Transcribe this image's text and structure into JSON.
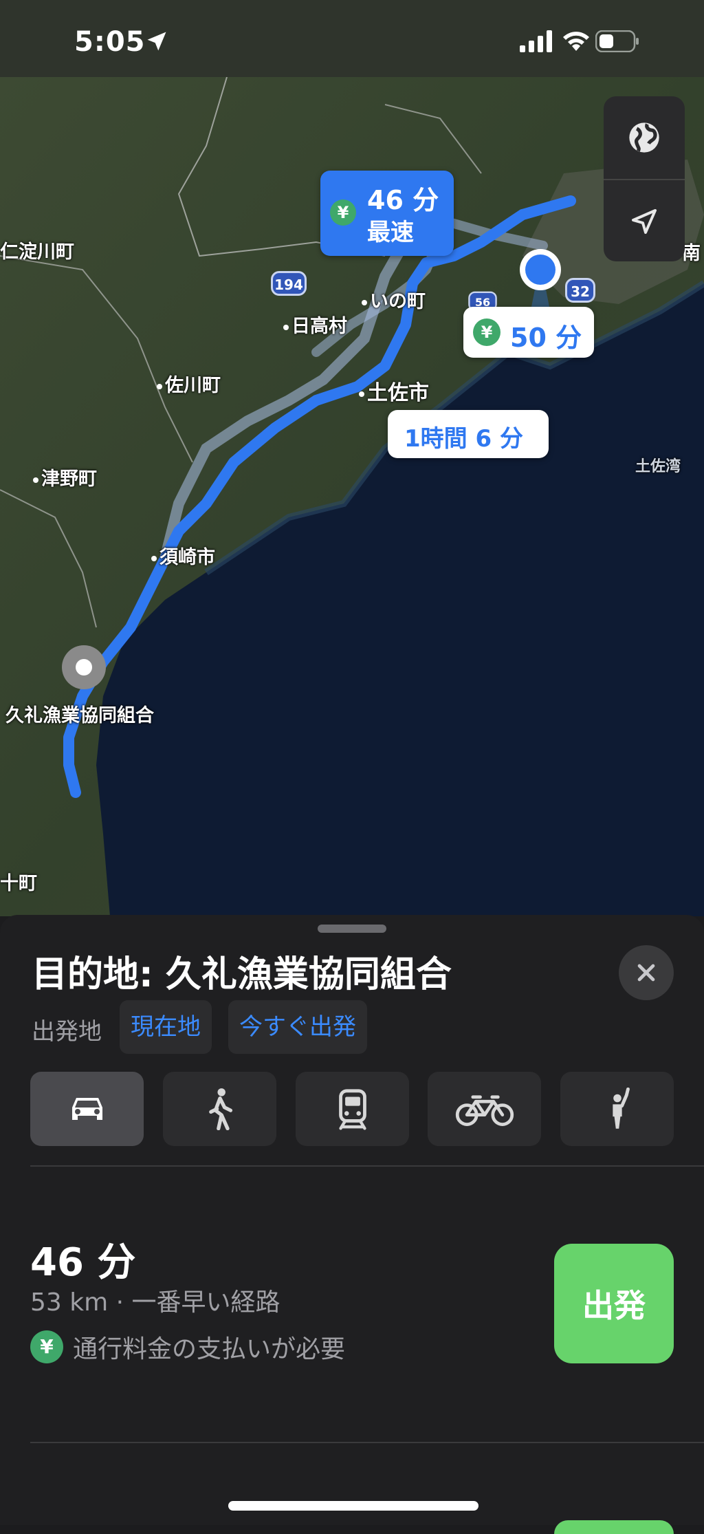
{
  "status": {
    "time": "5:05"
  },
  "map": {
    "places": {
      "niyodogawa": "仁淀川町",
      "ino": "いの町",
      "hidaka": "日高村",
      "sakawa": "佐川町",
      "tosa": "土佐市",
      "tsuno": "津野町",
      "susaki": "須崎市",
      "destination": "久礼漁業協同組合",
      "tosawan": "土佐湾",
      "nan": "南",
      "cho": "十町"
    },
    "shields": {
      "r194": "194",
      "r56": "56",
      "r32": "32"
    },
    "callouts": {
      "primary_time": "46 分",
      "primary_tag": "最速",
      "alt1_time": "50 分",
      "alt2_time": "1時間 6 分",
      "yen": "¥"
    }
  },
  "sheet": {
    "title": "目的地: 久礼漁業協同組合",
    "from_label": "出発地",
    "from_value": "現在地",
    "depart_time": "今すぐ出発",
    "route": {
      "time": "46 分",
      "detail": "53 km · 一番早い経路",
      "toll": "通行料金の支払いが必要",
      "yen": "¥"
    },
    "go_label": "出発"
  },
  "colors": {
    "accent": "#2f78f0",
    "go": "#67d36b",
    "toll": "#3fa86a"
  }
}
